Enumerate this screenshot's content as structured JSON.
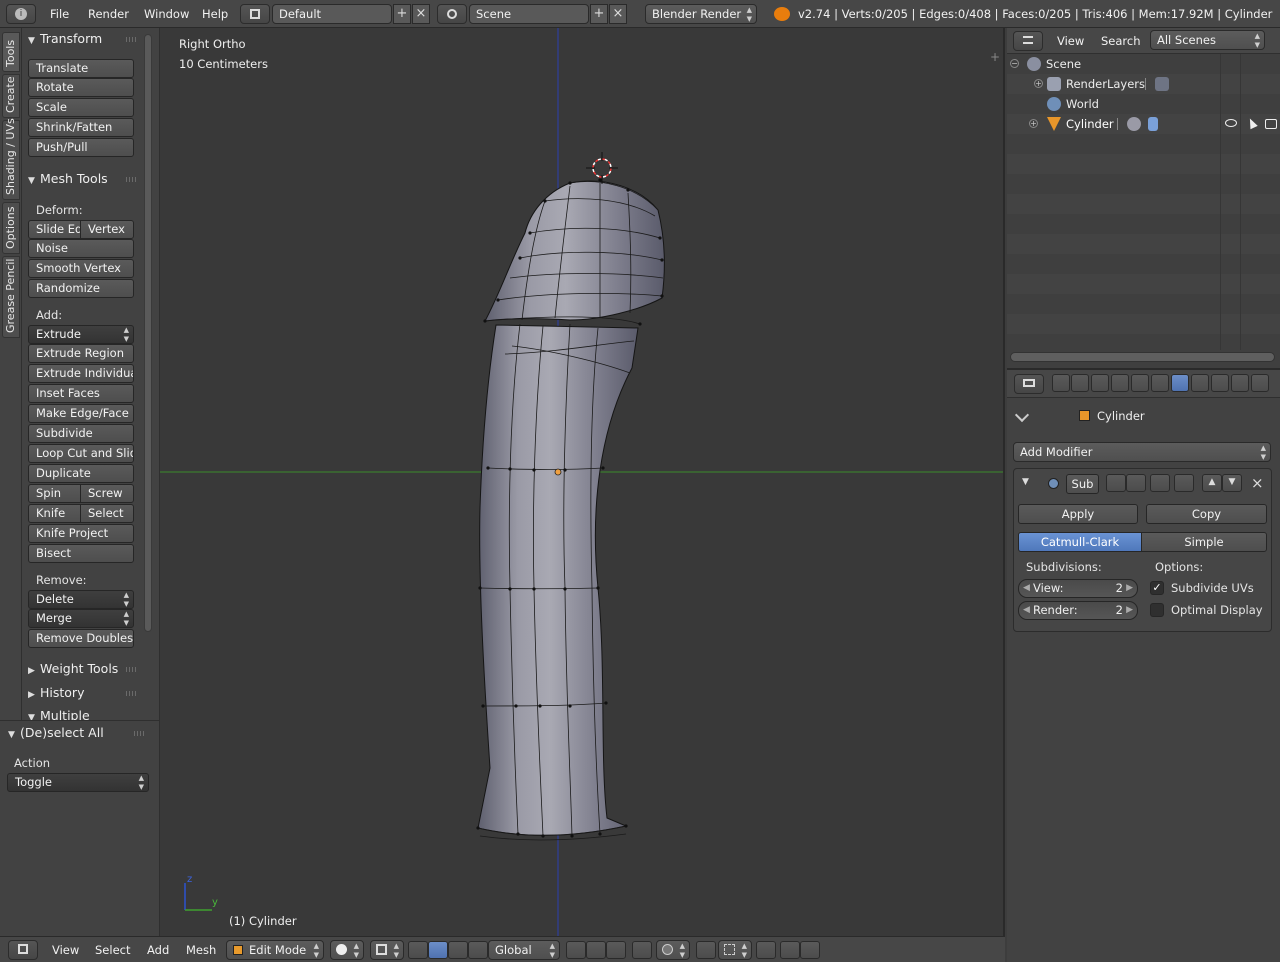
{
  "top_bar": {
    "menus": [
      "File",
      "Render",
      "Window",
      "Help"
    ],
    "screen_layout": "Default",
    "scene": "Scene",
    "render_engine": "Blender Render",
    "stats": "v2.74 | Verts:0/205 | Edges:0/408 | Faces:0/205 | Tris:406 | Mem:17.92M | Cylinder"
  },
  "tool_shelf": {
    "tabs": [
      "Tools",
      "Create",
      "Shading / UVs",
      "Options",
      "Grease Pencil"
    ],
    "transform": {
      "title": "Transform",
      "buttons": [
        "Translate",
        "Rotate",
        "Scale",
        "Shrink/Fatten",
        "Push/Pull"
      ]
    },
    "mesh_tools": {
      "title": "Mesh Tools",
      "deform_label": "Deform:",
      "slide_edge": "Slide Ed",
      "vertex": "Vertex",
      "noise": "Noise",
      "smooth_vertex": "Smooth Vertex",
      "randomize": "Randomize",
      "add_label": "Add:",
      "extrude": "Extrude",
      "extrude_region": "Extrude Region",
      "extrude_individual": "Extrude Individual",
      "inset_faces": "Inset Faces",
      "make_edge_face": "Make Edge/Face",
      "subdivide": "Subdivide",
      "loop_cut": "Loop Cut and Slide",
      "duplicate": "Duplicate",
      "spin": "Spin",
      "screw": "Screw",
      "knife": "Knife",
      "select": "Select",
      "knife_project": "Knife Project",
      "bisect": "Bisect",
      "remove_label": "Remove:",
      "delete": "Delete",
      "merge": "Merge",
      "remove_doubles": "Remove Doubles"
    },
    "collapsed_panels": [
      "Weight Tools",
      "History",
      "Multiple Objects"
    ]
  },
  "operator_panel": {
    "title": "(De)select All",
    "action_label": "Action",
    "action_value": "Toggle"
  },
  "viewport": {
    "view_name": "Right Ortho",
    "scale": "10 Centimeters",
    "object_label": "(1) Cylinder",
    "axis_z": "z",
    "axis_y": "y"
  },
  "bottom_bar": {
    "menus": [
      "View",
      "Select",
      "Add",
      "Mesh"
    ],
    "mode": "Edit Mode",
    "orientation": "Global"
  },
  "outliner": {
    "menus": [
      "View",
      "Search"
    ],
    "filter": "All Scenes",
    "items": [
      "Scene",
      "RenderLayers",
      "World",
      "Cylinder"
    ]
  },
  "properties": {
    "object_name": "Cylinder",
    "add_modifier": "Add Modifier",
    "modifier_name": "Sub",
    "apply": "Apply",
    "copy": "Copy",
    "catmull_clark": "Catmull-Clark",
    "simple": "Simple",
    "subdivisions_label": "Subdivisions:",
    "options_label": "Options:",
    "view_label": "View:",
    "view_value": "2",
    "render_label": "Render:",
    "render_value": "2",
    "subdivide_uvs": "Subdivide UVs",
    "subdivide_uvs_checked": true,
    "optimal_display": "Optimal Display",
    "optimal_display_checked": false
  },
  "colors": {
    "accent_blue": "#5680c2",
    "axis_green": "#3a8a2a",
    "axis_blue": "#2c3fb0",
    "background": "#393939"
  }
}
